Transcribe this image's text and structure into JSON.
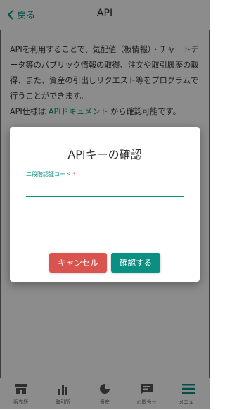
{
  "header": {
    "back_label": "戻る",
    "title": "API"
  },
  "description": {
    "paragraph": "APIを利用することで、気配値（板情報）・チャートデータ等のパブリック情報の取得、注文や取引履歴の取得、また、資産の引出しリクエスト等をプログラムで行うことができます。",
    "spec_prefix": "API仕様は",
    "spec_link": "APIドキュメント",
    "spec_suffix": "から確認可能です。"
  },
  "dialog": {
    "title": "APIキーの確認",
    "field_label": "二段階認証コード",
    "field_required_mark": "*",
    "field_value": "",
    "cancel_label": "キャンセル",
    "confirm_label": "確認する"
  },
  "nav": {
    "items": [
      {
        "label": "販売所",
        "icon": "store-icon"
      },
      {
        "label": "取引所",
        "icon": "bar-chart-icon"
      },
      {
        "label": "資産",
        "icon": "pie-chart-icon"
      },
      {
        "label": "お問合せ",
        "icon": "chat-icon"
      },
      {
        "label": "メニュー",
        "icon": "menu-icon"
      }
    ]
  },
  "colors": {
    "accent": "#0a8f83",
    "danger": "#d9534f",
    "overlay": "rgba(0,0,0,0.45)"
  }
}
